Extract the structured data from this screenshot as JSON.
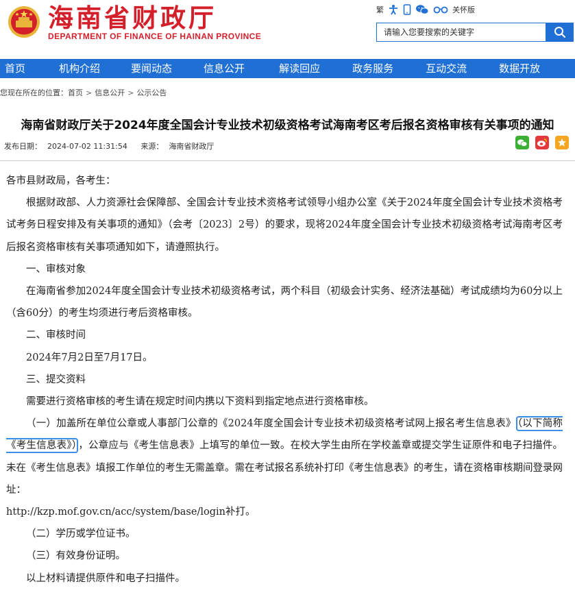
{
  "header": {
    "site_name_cn": "海南省财政厅",
    "site_name_en": "DEPARTMENT OF FINANCE OF HAINAN PROVINCE",
    "tools": {
      "traditional": "繁",
      "accessibility": "关怀版"
    },
    "icons": [
      "accessibility-person-icon",
      "mobile-icon",
      "wechat-icon",
      "glasses-icon"
    ],
    "search": {
      "placeholder": "请输入您要搜索的关键字"
    }
  },
  "nav": {
    "items": [
      "首页",
      "机构介绍",
      "要闻动态",
      "信息公开",
      "解读回应",
      "政务服务",
      "互动交流",
      "数据开放"
    ]
  },
  "breadcrumb": {
    "prefix": "您现在所在的位置：",
    "items": [
      "首页",
      "信息公开",
      "公示公告"
    ],
    "separator": ">"
  },
  "article": {
    "title": "海南省财政厅关于2024年度全国会计专业技术初级资格考试海南考区考后报名资格审核有关事项的通知",
    "date_label": "发布日期：",
    "date": "2024-07-02 11:31:54",
    "source_label": "来源：",
    "source": "海南省财政厅",
    "share_icons": [
      "wechat-share-icon",
      "weibo-share-icon",
      "favorite-star-icon"
    ],
    "body": {
      "salutation": "各市县财政局，各考生：",
      "p1": "根据财政部、人力资源社会保障部、全国会计专业技术资格考试领导小组办公室《关于2024年度全国会计专业技术资格考试考务日程安排及有关事项的通知》（会考〔2023〕2号）的要求，现将2024年度全国会计专业技术初级资格考试海南考区考后报名资格审核有关事项通知如下，请遵照执行。",
      "h1": "一、审核对象",
      "p2": "在海南省参加2024年度全国会计专业技术初级资格考试，两个科目（初级会计实务、经济法基础）考试成绩均为60分以上（含60分）的考生均须进行考后资格审核。",
      "h2": "二、审核时间",
      "p3": "2024年7月2日至7月17日。",
      "h3": "三、提交资料",
      "p4": "需要进行资格审核的考生请在规定时间内携以下资料到指定地点进行资格审核。",
      "p5_a": "（一）加盖所在单位公章或人事部门公章的《2024年度全国会计专业技术初级资格考试网上报名考生信息表》",
      "p5_hl": "（以下简称《考生信息表》）",
      "p5_b": "，公章应与《考生信息表》上填写的单位一致。在校大学生由所在学校盖章或提交学生证原件和电子扫描件。未在《考生信息表》填报工作单位的考生无需盖章。需在考试报名系统补打印《考生信息表》的考生，请在资格审核期间登录网址：",
      "url_line": "http://kzp.mof.gov.cn/acc/system/base/login补打。",
      "p6": "（二）学历或学位证书。",
      "p7": "（三）有效身份证明。",
      "p8": "以上材料请提供原件和电子扫描件。"
    }
  },
  "colors": {
    "brand_red": "#d4202a",
    "nav_blue": "#1f6fd4",
    "highlight_border": "#3a8ee6",
    "wechat_green": "#3cb034",
    "weibo_red": "#e4393c",
    "favorite_orange": "#f5a623"
  }
}
